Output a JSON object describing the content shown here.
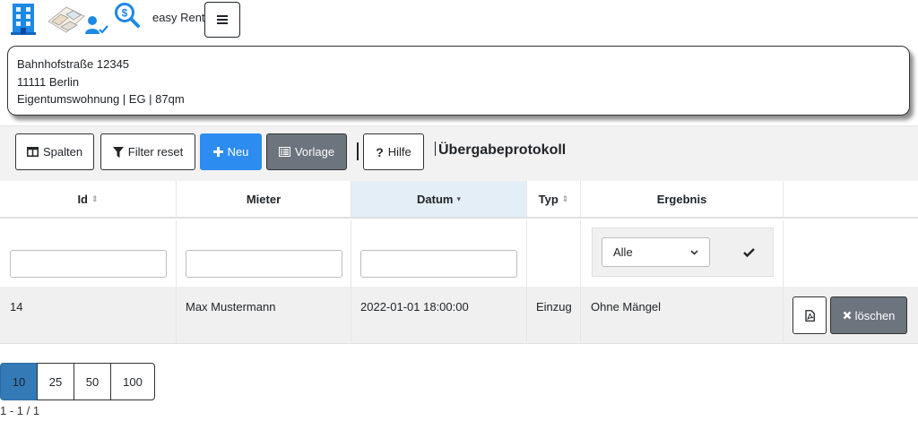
{
  "header": {
    "brand": "easy Rent",
    "menu_icon": "hamburger-icon"
  },
  "address": {
    "street": "Bahnhofstraße 12345",
    "city": "11111 Berlin",
    "details": "Eigentumswohnung | EG | 87qm"
  },
  "toolbar": {
    "columns_label": "Spalten",
    "filter_reset_label": "Filter reset",
    "new_label": "Neu",
    "template_label": "Vorlage",
    "help_label": "Hilfe",
    "title": "Übergabeprotokoll"
  },
  "table": {
    "columns": [
      "Id",
      "Mieter",
      "Datum",
      "Typ",
      "Ergebnis"
    ],
    "sorted_column": "Datum",
    "filter": {
      "ergebnis_select": "Alle"
    },
    "rows": [
      {
        "id": "14",
        "mieter": "Max Mustermann",
        "datum": "2022-01-01 18:00:00",
        "typ": "Einzug",
        "ergebnis": "Ohne Mängel",
        "delete_label": "löschen"
      }
    ]
  },
  "pagination": {
    "sizes": [
      "10",
      "25",
      "50",
      "100"
    ],
    "active_size": "10",
    "info": "1 - 1 / 1"
  },
  "colors": {
    "primary": "#2d8cf0",
    "secondary": "#6c757d",
    "page_active": "#337ab7",
    "sorted_header": "#e3eef7"
  }
}
